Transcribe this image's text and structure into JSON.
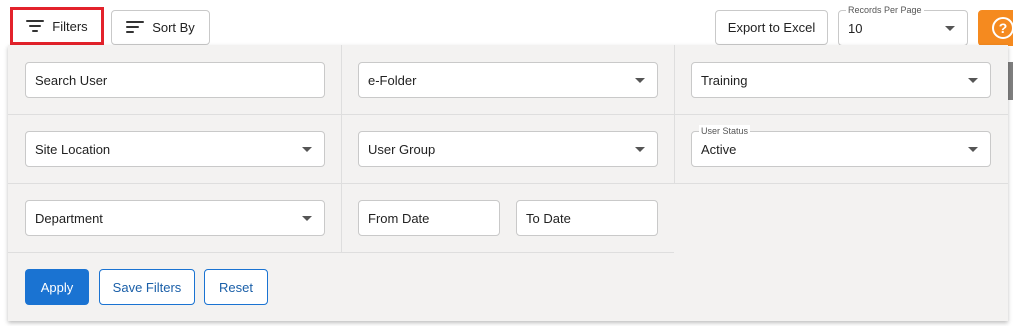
{
  "toolbar": {
    "filters_label": "Filters",
    "sortby_label": "Sort By",
    "export_label": "Export to Excel",
    "records_per_page": {
      "label": "Records Per Page",
      "value": "10"
    },
    "help_glyph": "?"
  },
  "filters": {
    "search_user": {
      "placeholder": "Search User"
    },
    "e_folder": {
      "value": "e-Folder"
    },
    "training": {
      "value": "Training"
    },
    "site_location": {
      "value": "Site Location"
    },
    "user_group": {
      "value": "User Group"
    },
    "user_status": {
      "label": "User Status",
      "value": "Active"
    },
    "department": {
      "value": "Department"
    },
    "from_date": {
      "placeholder": "From Date"
    },
    "to_date": {
      "placeholder": "To Date"
    }
  },
  "actions": {
    "apply_label": "Apply",
    "save_filters_label": "Save Filters",
    "reset_label": "Reset"
  },
  "colors": {
    "highlight": "#e3222b",
    "primary": "#1a73d2",
    "help": "#f58a1f"
  }
}
